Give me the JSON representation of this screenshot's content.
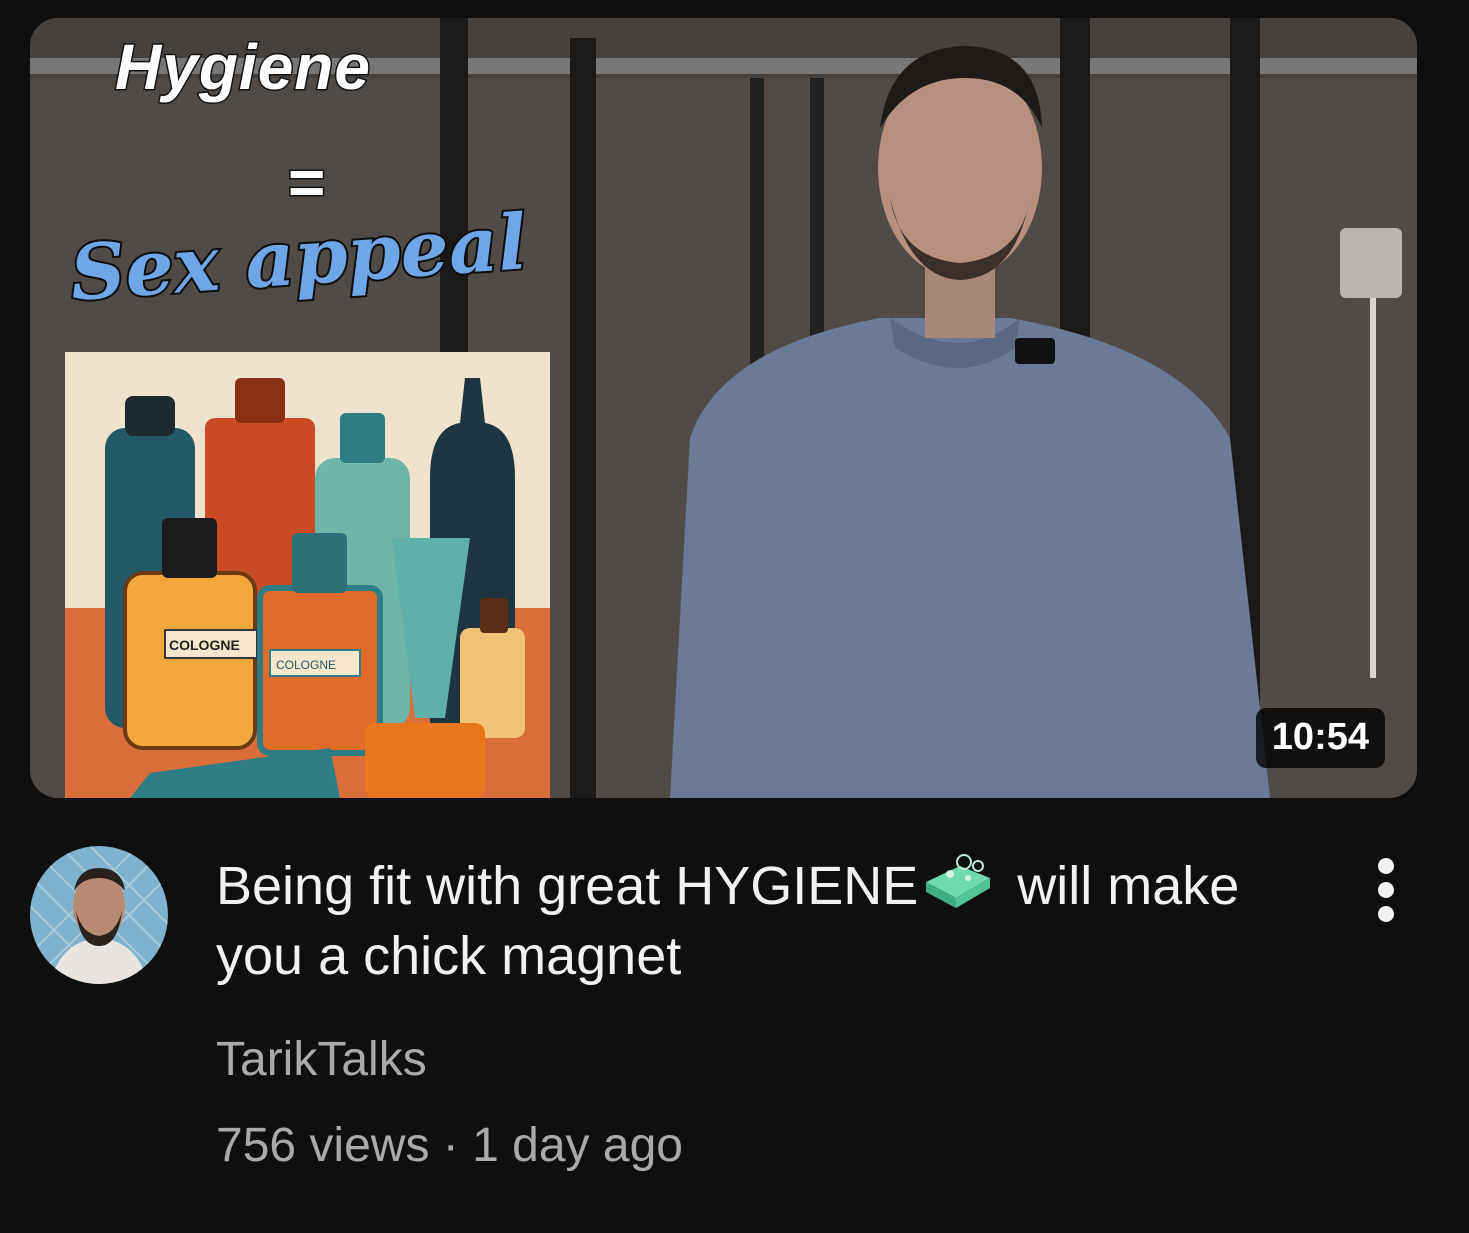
{
  "video": {
    "overlay_title": "Hygiene",
    "overlay_equals": "=",
    "overlay_subtitle": "Sex appeal",
    "bottle_label_1": "COLOGNE",
    "bottle_label_2": "COLOGNE",
    "duration": "10:54",
    "title_part1": "Being fit with great HYGIENE",
    "title_emoji": "soap-emoji",
    "title_part2": " will make you a chick magnet",
    "channel": "TarikTalks",
    "views": "756 views",
    "separator": "·",
    "age": "1 day ago"
  },
  "icons": {
    "menu": "more-vert-icon",
    "soap": "soap-icon"
  },
  "colors": {
    "background": "#0f0f0f",
    "title_text": "#f1f1f1",
    "secondary_text": "#aaaaaa",
    "subtitle_blue": "#6fa6e8"
  }
}
